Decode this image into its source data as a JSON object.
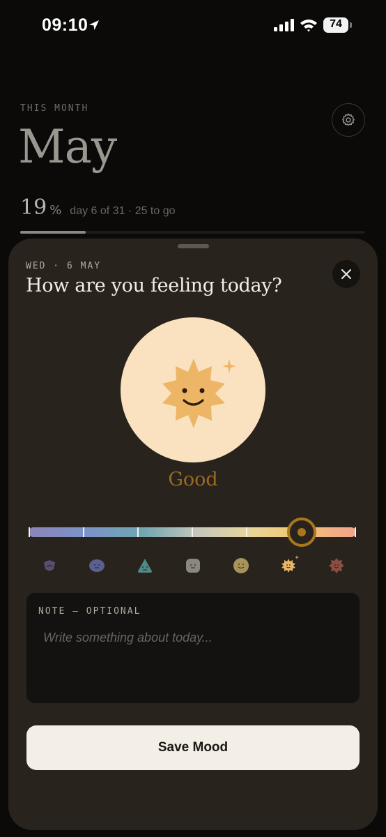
{
  "status_bar": {
    "time": "09:10",
    "battery": "74"
  },
  "header": {
    "section_label": "THIS MONTH",
    "month": "May",
    "progress_percent": "19",
    "progress_unit": "%",
    "progress_text": "day 6 of 31 · 25 to go",
    "progress_fraction": 0.19
  },
  "sheet": {
    "date_label": "WED · 6 MAY",
    "question": "How are you feeling today?",
    "selected_mood": "Good",
    "selected_index": 5,
    "scale_moods": [
      "awful",
      "bad",
      "meh",
      "okay",
      "fine",
      "good",
      "great"
    ],
    "note": {
      "label": "NOTE — OPTIONAL",
      "placeholder": "Write something about today...",
      "value": ""
    },
    "save_label": "Save Mood"
  },
  "colors": {
    "accent": "#a8771c",
    "sheet_bg": "#28231d",
    "page_bg": "#0b0a09",
    "mood_circle": "#fae2c1",
    "mood_face": "#edb666"
  }
}
